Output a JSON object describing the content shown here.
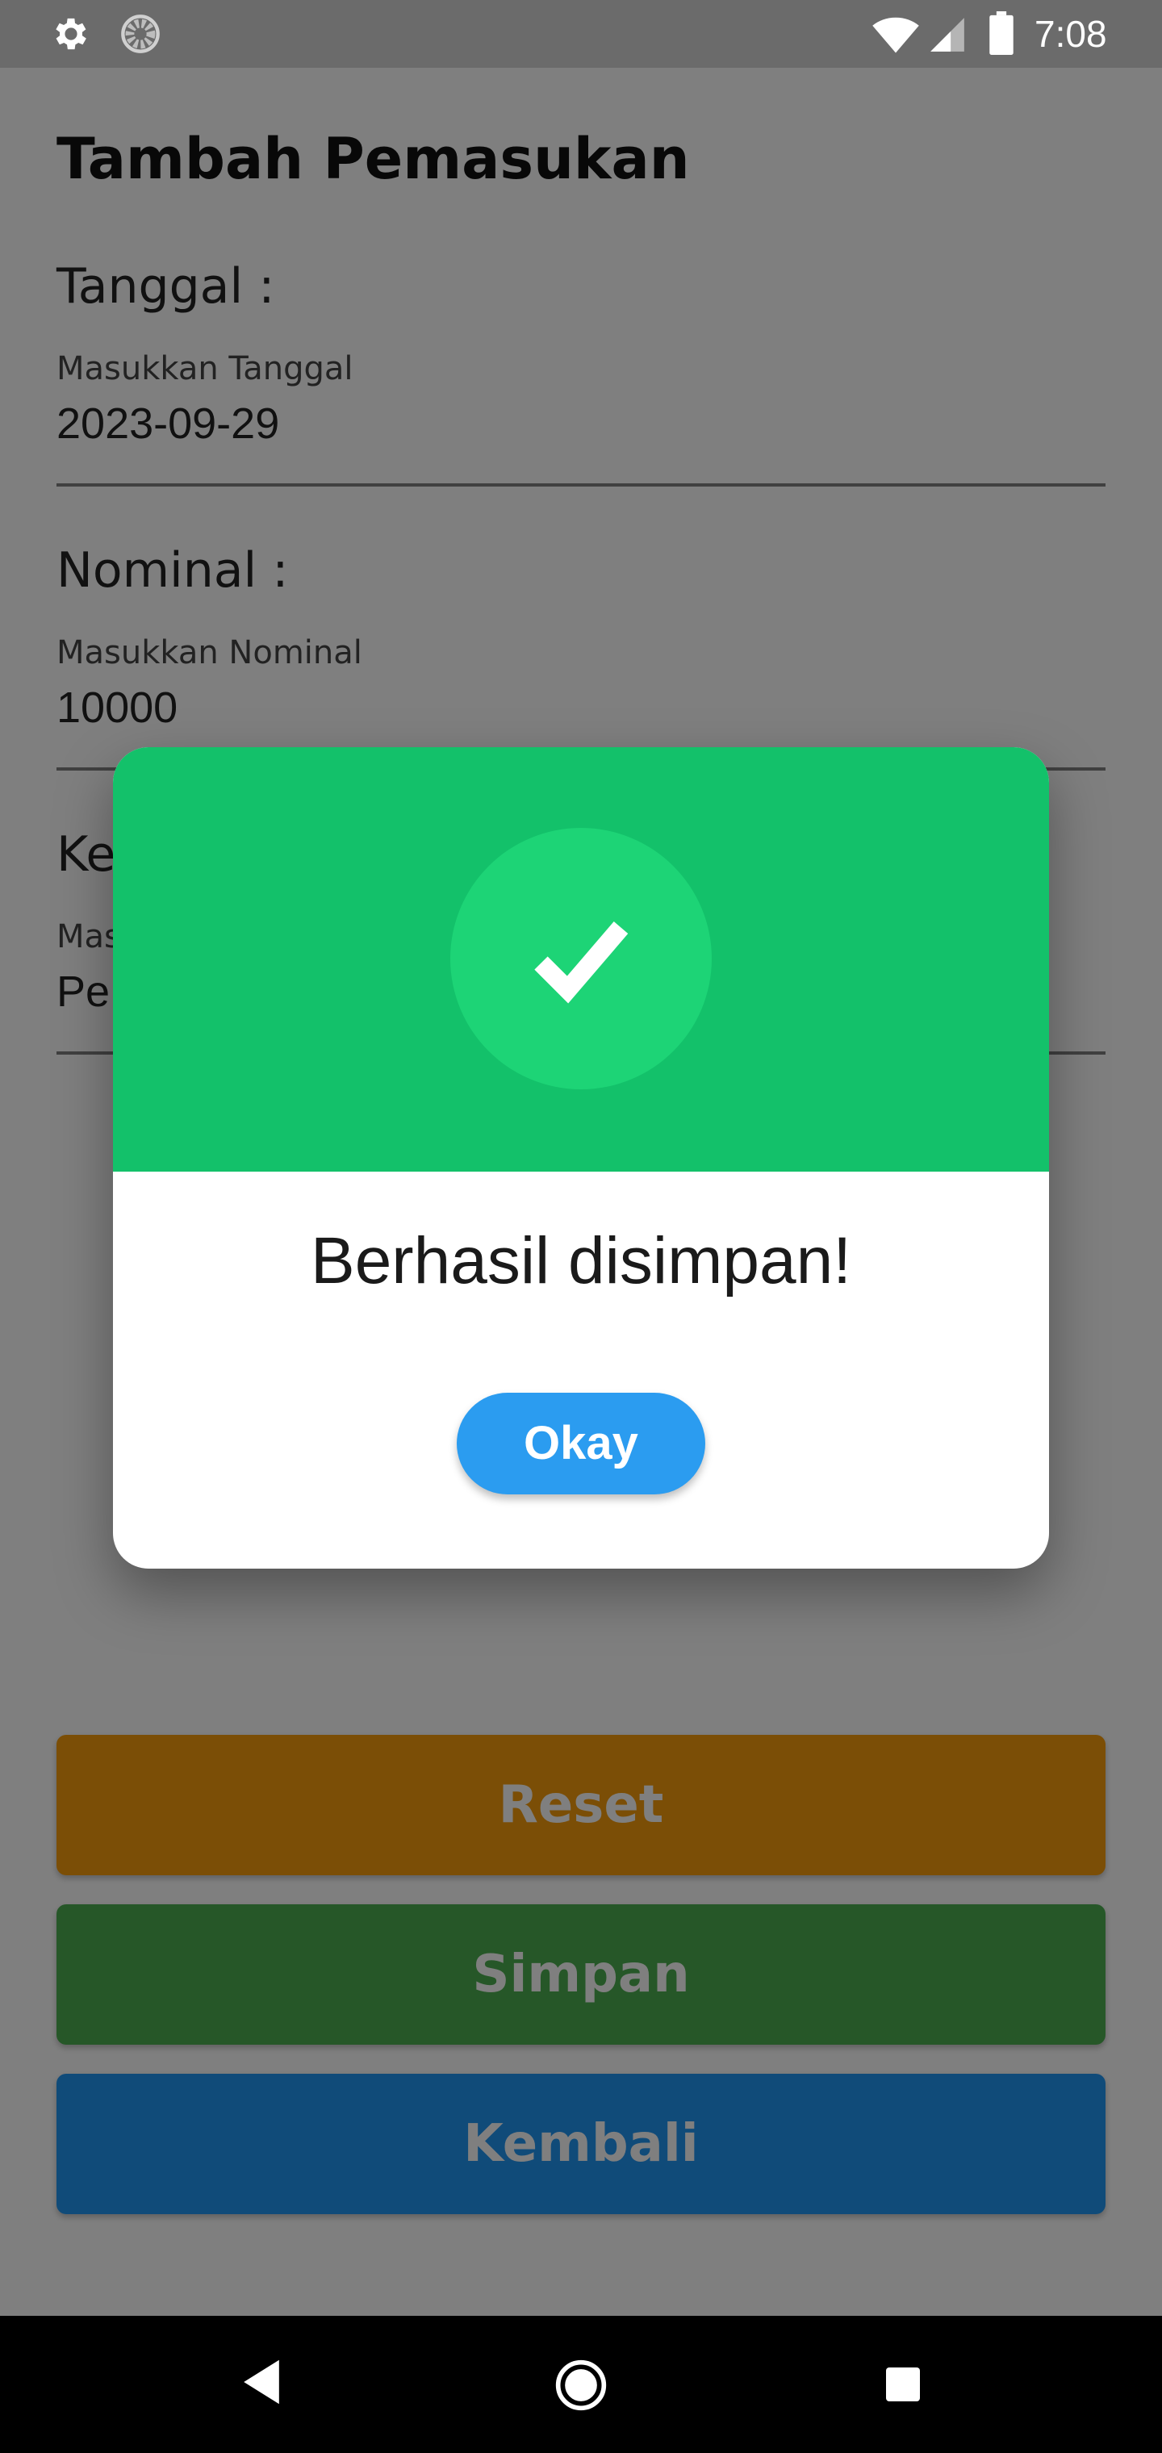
{
  "status_bar": {
    "time": "7:08",
    "icons": [
      "gear-icon",
      "spinner-icon",
      "wifi-icon",
      "signal-icon",
      "battery-icon"
    ]
  },
  "form": {
    "title": "Tambah Pemasukan",
    "tanggal": {
      "label": "Tanggal :",
      "hint": "Masukkan Tanggal",
      "value": "2023-09-29"
    },
    "nominal": {
      "label": "Nominal :",
      "hint": "Masukkan Nominal",
      "value": "10000"
    },
    "keterangan": {
      "label_visible": "Ke",
      "hint_visible": "Mas",
      "value_visible": "Pe"
    }
  },
  "buttons": {
    "reset": "Reset",
    "simpan": "Simpan",
    "kembali": "Kembali"
  },
  "dialog": {
    "message": "Berhasil disimpan!",
    "okay": "Okay"
  },
  "colors": {
    "reset": "#f79c0c",
    "simpan": "#4caf50",
    "kembali": "#2196f3",
    "dialog_header": "#13c16a",
    "dialog_circle": "#1dd476",
    "okay_button": "#2b9cf0"
  }
}
